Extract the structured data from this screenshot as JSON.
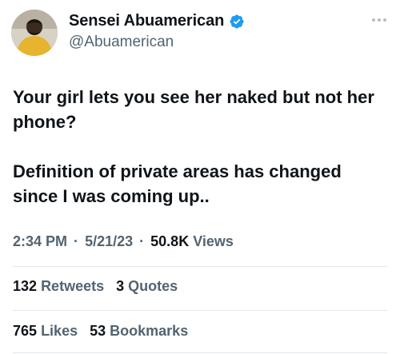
{
  "author": {
    "display_name": "Sensei Abuamerican",
    "handle": "@Abuamerican",
    "verified_color": "#1d9bf0"
  },
  "tweet": {
    "paragraphs": [
      "Your girl lets you see her naked but not her phone?",
      "Definition of private areas has changed since I was coming up.."
    ],
    "time": "2:34 PM",
    "date": "5/21/23",
    "views_count": "50.8K",
    "views_label": "Views",
    "separator": "·"
  },
  "stats": {
    "retweets_count": "132",
    "retweets_label": "Retweets",
    "quotes_count": "3",
    "quotes_label": "Quotes",
    "likes_count": "765",
    "likes_label": "Likes",
    "bookmarks_count": "53",
    "bookmarks_label": "Bookmarks"
  },
  "icons": {
    "verified": "verified-badge-icon",
    "more": "more-options-icon"
  }
}
